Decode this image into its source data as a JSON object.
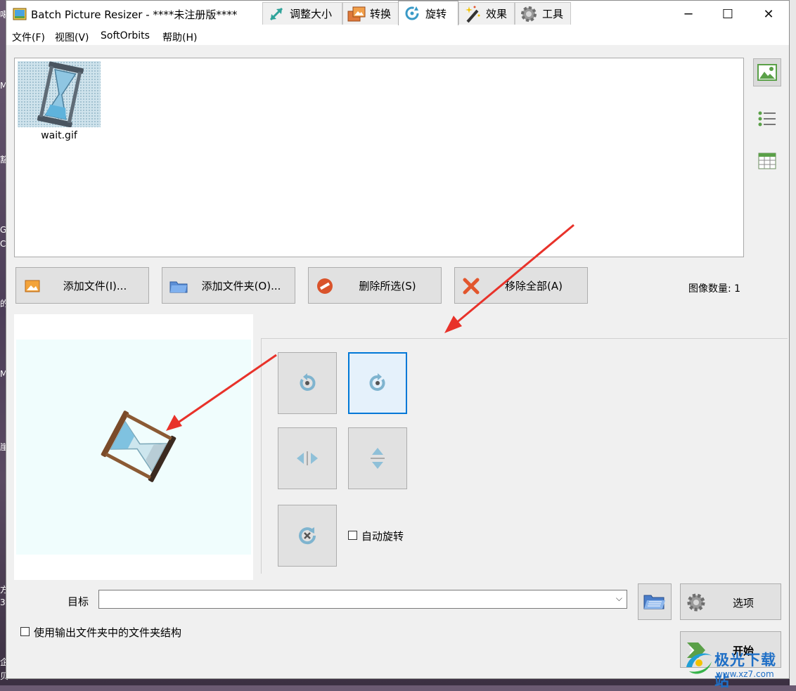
{
  "window": {
    "title": "Batch Picture Resizer - ****未注册版****",
    "controls": {
      "minimize": "─",
      "maximize": "☐",
      "close": "✕"
    }
  },
  "menu": [
    "文件(F)",
    "视图(V)",
    "SoftOrbits",
    "帮助(H)"
  ],
  "files": [
    {
      "name": "wait.gif"
    }
  ],
  "actions": {
    "add_file": "添加文件(I)...",
    "add_folder": "添加文件夹(O)...",
    "remove_selected": "删除所选(S)",
    "remove_all": "移除全部(A)"
  },
  "image_count": "图像数量: 1",
  "tabs": [
    {
      "label": "调整大小",
      "icon": "resize-icon"
    },
    {
      "label": "转换",
      "icon": "convert-icon"
    },
    {
      "label": "旋转",
      "icon": "rotate-icon",
      "active": true
    },
    {
      "label": "效果",
      "icon": "magic-wand-icon"
    },
    {
      "label": "工具",
      "icon": "gear-icon"
    }
  ],
  "rotate": {
    "auto_rotate_label": "自动旋转",
    "auto_rotate_checked": false,
    "selected_button": "rotate-right"
  },
  "target": {
    "label": "目标",
    "value": ""
  },
  "options_label": "选项",
  "start_label": "开始",
  "keep_structure_label": "使用输出文件夹中的文件夹结构",
  "keep_structure_checked": false,
  "watermark": {
    "name": "极光下载站",
    "url": "www.xz7.com"
  },
  "desktop_glyphs": [
    "噶",
    "M",
    "豁",
    "G",
    "C",
    "的",
    "M",
    "崖",
    "方",
    "3",
    "企",
    "贝"
  ],
  "colors": {
    "accent": "#0078d7",
    "annotation_arrow": "#e8322a",
    "rotate_icon": "#6aa9c9",
    "watermark": "#1f6fc6"
  }
}
